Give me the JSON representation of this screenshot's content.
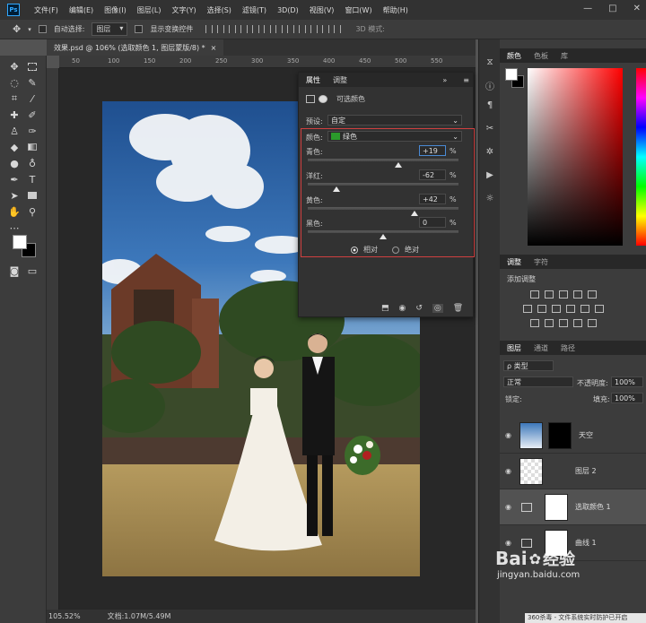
{
  "app": {
    "logo": "Ps"
  },
  "menu": [
    "文件(F)",
    "编辑(E)",
    "图像(I)",
    "图层(L)",
    "文字(Y)",
    "选择(S)",
    "滤镜(T)",
    "3D(D)",
    "视图(V)",
    "窗口(W)",
    "帮助(H)"
  ],
  "window_controls": [
    "—",
    "□",
    "✕"
  ],
  "options_bar": {
    "auto_select_label": "自动选择:",
    "auto_select_value": "图层",
    "show_transform_label": "显示变换控件",
    "mode_3d": "3D 模式:"
  },
  "document_tab": {
    "title": "效果.psd @ 106% (选取颜色 1, 图层蒙版/8) *",
    "close": "×"
  },
  "ruler": {
    "ticks": [
      "50",
      "100",
      "150",
      "200",
      "250",
      "300",
      "350",
      "400",
      "450",
      "500",
      "550"
    ]
  },
  "status": {
    "zoom": "105.52%",
    "doc": "文档:1.07M/5.49M"
  },
  "properties": {
    "tabs": [
      "属性",
      "调整"
    ],
    "title": "可选颜色",
    "preset_label": "预设:",
    "preset_value": "自定",
    "color_label": "颜色:",
    "color_value": "绿色",
    "sliders": [
      {
        "label": "青色:",
        "value": "+19",
        "unit": "%",
        "level": 0.6
      },
      {
        "label": "洋红:",
        "value": "-62",
        "unit": "%",
        "level": 0.19
      },
      {
        "label": "黄色:",
        "value": "+42",
        "unit": "%",
        "level": 0.71
      },
      {
        "label": "黑色:",
        "value": "0",
        "unit": "%",
        "level": 0.5
      }
    ],
    "relative_label": "相对",
    "absolute_label": "绝对"
  },
  "color_panel": {
    "tabs": [
      "颜色",
      "色板",
      "库"
    ]
  },
  "adjust_panel": {
    "tabs": [
      "调整",
      "字符"
    ],
    "subtitle": "添加调整"
  },
  "layers_panel": {
    "tabs": [
      "图层",
      "通道",
      "路径"
    ],
    "filter": "ρ 类型",
    "blend_mode": "正常",
    "opacity_label": "不透明度:",
    "opacity_value": "100%",
    "lock_label": "锁定:",
    "fill_label": "填充:",
    "fill_value": "100%",
    "layers": [
      {
        "name": "天空"
      },
      {
        "name": "图层 2"
      },
      {
        "name": "选取颜色 1"
      },
      {
        "name": "曲线 1"
      }
    ]
  },
  "watermark": {
    "brand": "Bai",
    "brand2": "经验",
    "url": "jingyan.baidu.com"
  },
  "bottom_note": "360杀毒 - 文件系统实时防护已开启"
}
